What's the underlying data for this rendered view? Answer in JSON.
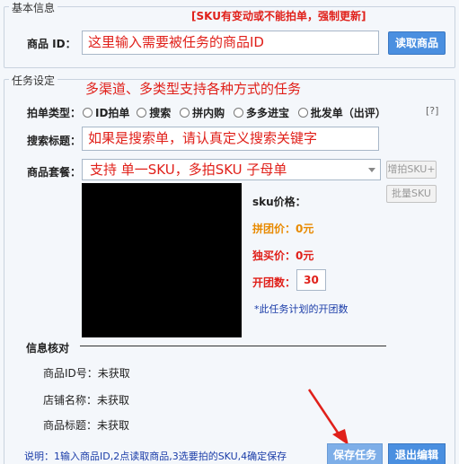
{
  "basic": {
    "legend": "基本信息",
    "warning": "[SKU有变动或不能拍单，强制更新]",
    "product_id_label": "商品 ID：",
    "product_id_value": "这里输入需要被任务的商品ID",
    "fetch_button": "读取商品"
  },
  "task": {
    "legend": "任务设定",
    "note": "多渠道、多类型支持各种方式的任务",
    "order_type_label": "拍单类型：",
    "order_types": [
      "ID拍单",
      "搜索",
      "拼内购",
      "多多进宝",
      "批发单（出评）"
    ],
    "help": "[?]",
    "search_title_label": "搜索标题：",
    "search_title_value": "如果是搜索单，请认真定义搜索关键字",
    "package_label": "商品套餐：",
    "package_value": "支持 单一SKU，多拍SKU 子母单",
    "add_sku_button": "增拍SKU+",
    "batch_sku_button": "批量SKU",
    "sku_price_label": "sku价格：",
    "group_price": "拼团价：0元",
    "single_price": "独买价：0元",
    "group_count_label": "开团数：",
    "group_count_value": "30",
    "plan_note": "*此任务计划的开团数"
  },
  "verify": {
    "title": "信息核对",
    "rows": [
      {
        "label": "商品ID号：",
        "value": "未获取"
      },
      {
        "label": "店铺名称：",
        "value": "未获取"
      },
      {
        "label": "商品标题：",
        "value": "未获取"
      }
    ]
  },
  "footer": {
    "note": "说明：1输入商品ID,2点读取商品,3选要拍的SKU,4确定保存",
    "save_button": "保存任务",
    "exit_button": "退出编辑"
  },
  "colors": {
    "accent": "#4a8fe0",
    "warning_red": "#e0201a",
    "orange": "#e88a00",
    "note_blue": "#1a3ca8"
  }
}
